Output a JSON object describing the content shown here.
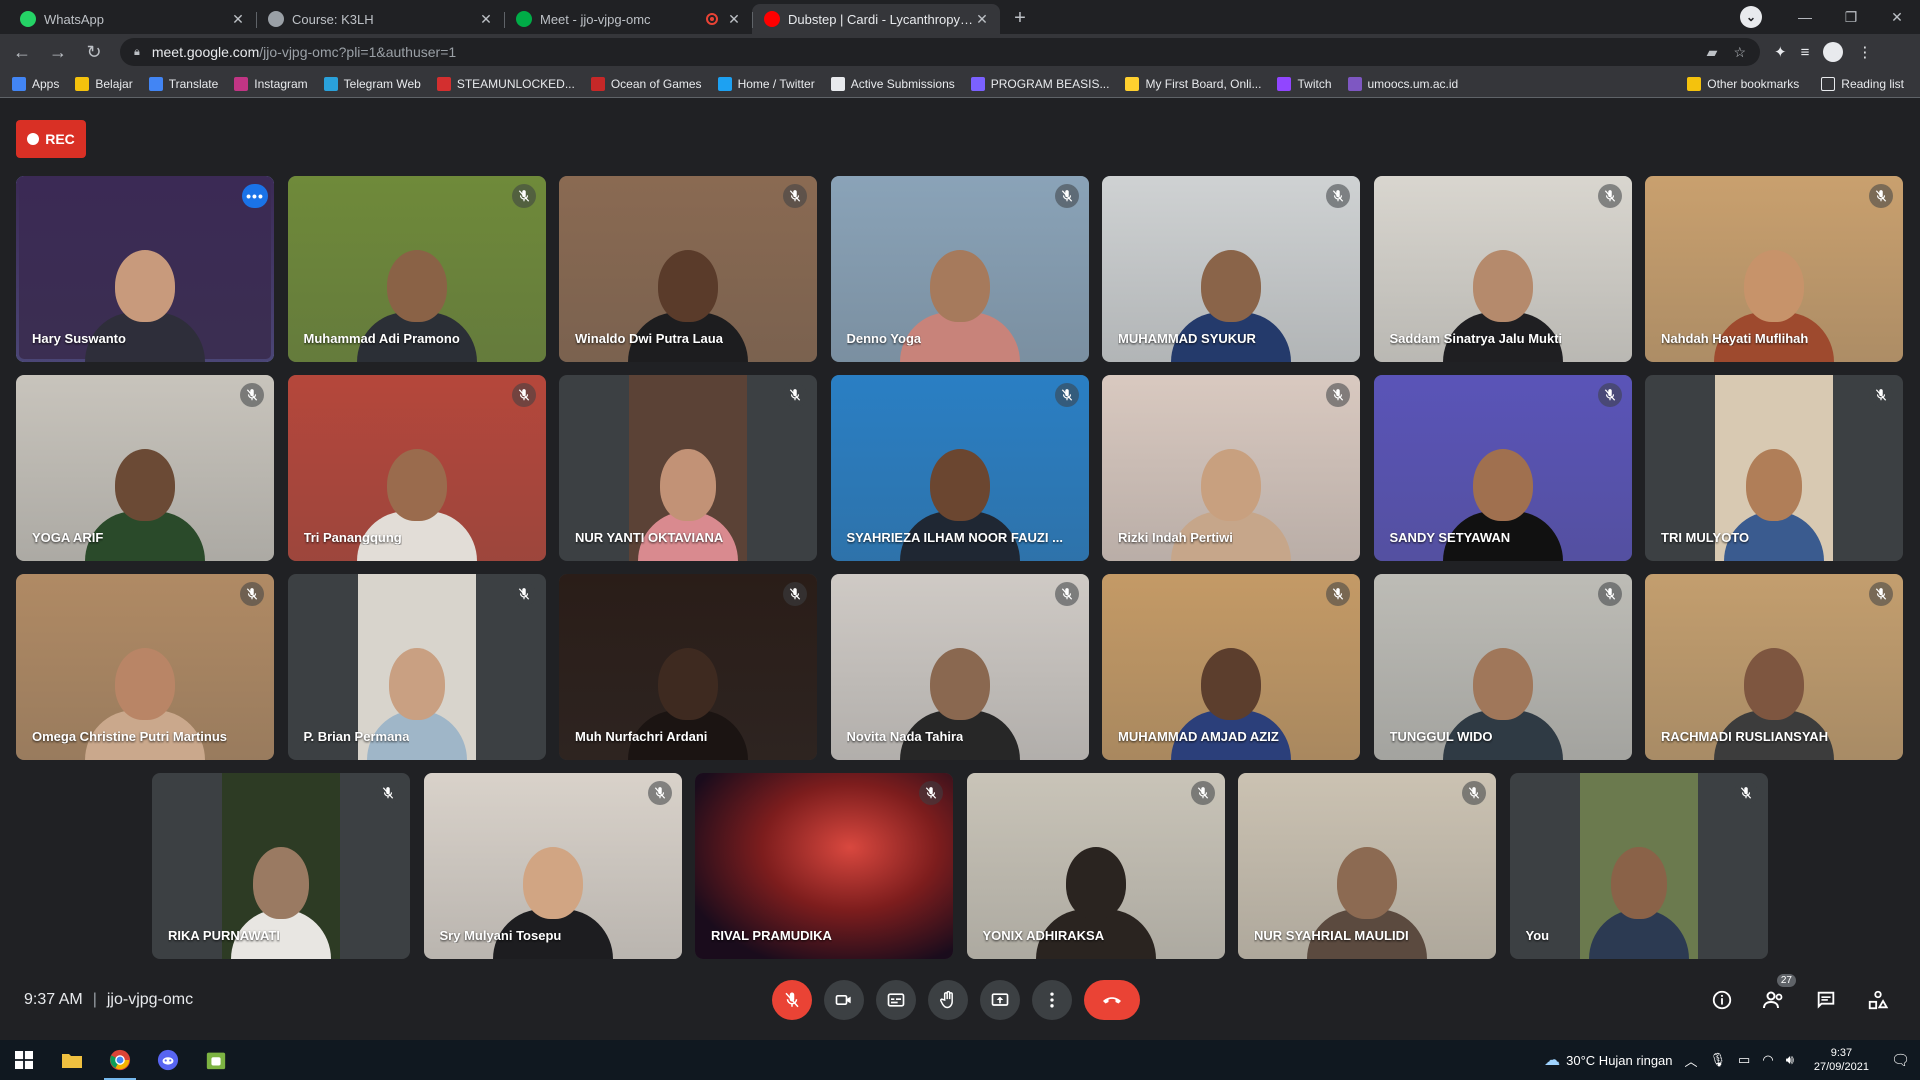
{
  "browser": {
    "tabs": [
      {
        "title": "WhatsApp",
        "icon": "whatsapp-icon",
        "color": "#25d366",
        "active": false
      },
      {
        "title": "Course: K3LH",
        "icon": "moodle-icon",
        "color": "#9aa0a6",
        "active": false
      },
      {
        "title": "Meet - jjo-vjpg-omc",
        "icon": "meet-icon",
        "color": "#00ac47",
        "active": false,
        "recording": true
      },
      {
        "title": "Dubstep | Cardi - Lycanthropy - Y",
        "icon": "youtube-icon",
        "color": "#ff0000",
        "active": true
      }
    ],
    "url_host": "meet.google.com",
    "url_path": "/jjo-vjpg-omc?pli=1&authuser=1",
    "bookmarks": [
      {
        "label": "Apps",
        "icon": "apps-grid-icon",
        "color": "#4285f4"
      },
      {
        "label": "Belajar",
        "icon": "folder-icon",
        "color": "#f4c20d"
      },
      {
        "label": "Translate",
        "icon": "translate-icon",
        "color": "#4285f4"
      },
      {
        "label": "Instagram",
        "icon": "instagram-icon",
        "color": "#c13584"
      },
      {
        "label": "Telegram Web",
        "icon": "telegram-icon",
        "color": "#2aa1da"
      },
      {
        "label": "STEAMUNLOCKED...",
        "icon": "steam-icon",
        "color": "#d32f2f"
      },
      {
        "label": "Ocean of Games",
        "icon": "ocean-icon",
        "color": "#c62828"
      },
      {
        "label": "Home / Twitter",
        "icon": "twitter-icon",
        "color": "#1da1f2"
      },
      {
        "label": "Active Submissions",
        "icon": "submissions-icon",
        "color": "#e8eaed"
      },
      {
        "label": "PROGRAM BEASIS...",
        "icon": "list-icon",
        "color": "#7b61ff"
      },
      {
        "label": "My First Board, Onli...",
        "icon": "miro-icon",
        "color": "#ffd02f"
      },
      {
        "label": "Twitch",
        "icon": "twitch-icon",
        "color": "#9146ff"
      },
      {
        "label": "umoocs.um.ac.id",
        "icon": "umoocs-icon",
        "color": "#7e57c2"
      }
    ],
    "other_bookmarks": "Other bookmarks",
    "reading_list": "Reading list"
  },
  "meet": {
    "rec_label": "REC",
    "time": "9:37 AM",
    "meeting_code": "jjo-vjpg-omc",
    "people_count": "27",
    "participants": [
      {
        "name": "Hary Suswanto",
        "speaking": true,
        "bg": "#3b2a55",
        "skin": "#c89a7c",
        "shirt": "#2e2e3a"
      },
      {
        "name": "Muhammad Adi Pramono",
        "bg": "#6f8a3a",
        "skin": "#8a6246",
        "shirt": "#2b2f36"
      },
      {
        "name": "Winaldo Dwi Putra Laua",
        "bg": "#8a6a52",
        "skin": "#5a3b2a",
        "shirt": "#1d1d1f"
      },
      {
        "name": "Denno Yoga",
        "bg": "#8aa3b8",
        "skin": "#a67a5c",
        "shirt": "#c8837a"
      },
      {
        "name": "MUHAMMAD SYUKUR",
        "bg": "#cfd2d3",
        "skin": "#8a6449",
        "shirt": "#243a6b"
      },
      {
        "name": "Saddam Sinatrya Jalu Mukti",
        "bg": "#d9d6cf",
        "skin": "#b58a6c",
        "shirt": "#1f1f22"
      },
      {
        "name": "Nahdah Hayati Muflihah",
        "bg": "#c9a06e",
        "skin": "#c7936a",
        "shirt": "#9e4a2e"
      },
      {
        "name": "YOGA ARIF",
        "bg": "#c8c4bc",
        "skin": "#6b4a35",
        "shirt": "#2a4a2a"
      },
      {
        "name": "Tri Panangqung",
        "bg": "#b5473b",
        "skin": "#9a6b4d",
        "shirt": "#e2ddd7"
      },
      {
        "name": "NUR YANTI OKTAVIANA",
        "bg": "#5b4236",
        "skin": "#c29276",
        "shirt": "#d98a8f",
        "inset": true
      },
      {
        "name": "SYAHRIEZA ILHAM NOOR FAUZI ...",
        "bg": "#2a7fc4",
        "skin": "#6b4630",
        "shirt": "#1f2733"
      },
      {
        "name": "Rizki Indah Pertiwi",
        "bg": "#d9c9c0",
        "skin": "#c8a07f",
        "shirt": "#c6a68a"
      },
      {
        "name": "SANDY SETYAWAN",
        "bg": "#5a54b8",
        "skin": "#a0704f",
        "shirt": "#111111"
      },
      {
        "name": "TRI MULYOTO",
        "bg": "#d8c9b2",
        "skin": "#b07e58",
        "shirt": "#3a5b8f",
        "inset": true
      },
      {
        "name": "Omega Christine Putri Martinus",
        "bg": "#b08a64",
        "skin": "#b98566",
        "shirt": "#caa88c"
      },
      {
        "name": "P. Brian Permana",
        "bg": "#d8d4cc",
        "skin": "#c9a082",
        "shirt": "#9fb6c8",
        "inset": true
      },
      {
        "name": "Muh Nurfachri Ardani",
        "bg": "#2a1d18",
        "skin": "#3e2a20",
        "shirt": "#1b1412"
      },
      {
        "name": "Novita Nada Tahira",
        "bg": "#cfcac5",
        "skin": "#8a6850",
        "shirt": "#272727"
      },
      {
        "name": "MUHAMMAD AMJAD AZIZ",
        "bg": "#c49a66",
        "skin": "#5c3e2d",
        "shirt": "#2b3f7a"
      },
      {
        "name": "TUNGGUL WIDO",
        "bg": "#bdbcb6",
        "skin": "#a0775a",
        "shirt": "#2f3a44"
      },
      {
        "name": "RACHMADI RUSLIANSYAH",
        "bg": "#c39e6e",
        "skin": "#7e5640",
        "shirt": "#3c3c3c"
      },
      {
        "name": "RIKA PURNAWATI",
        "bg": "#2d3b24",
        "skin": "#9a7a62",
        "shirt": "#e8e6e2",
        "inset": true
      },
      {
        "name": "Sry Mulyani Tosepu",
        "bg": "#d9d2ca",
        "skin": "#d1a583",
        "shirt": "#1d1d20"
      },
      {
        "name": "RIVAL PRAMUDIKA",
        "bg": "#7d1d1d",
        "skin": "#7d1d1d",
        "shirt": "#3a0e14",
        "space": true
      },
      {
        "name": "YONIX ADHIRAKSA",
        "bg": "#c9c4b8",
        "skin": "#2a2420",
        "shirt": "#2a2420"
      },
      {
        "name": "NUR SYAHRIAL MAULIDI",
        "bg": "#cbc2b2",
        "skin": "#8c6a52",
        "shirt": "#5b4a3f"
      },
      {
        "name": "You",
        "bg": "#6b7a4e",
        "skin": "#8a6248",
        "shirt": "#2c3a52",
        "inset": true
      }
    ]
  },
  "taskbar": {
    "weather": "30°C  Hujan ringan",
    "time": "9:37",
    "date": "27/09/2021"
  }
}
